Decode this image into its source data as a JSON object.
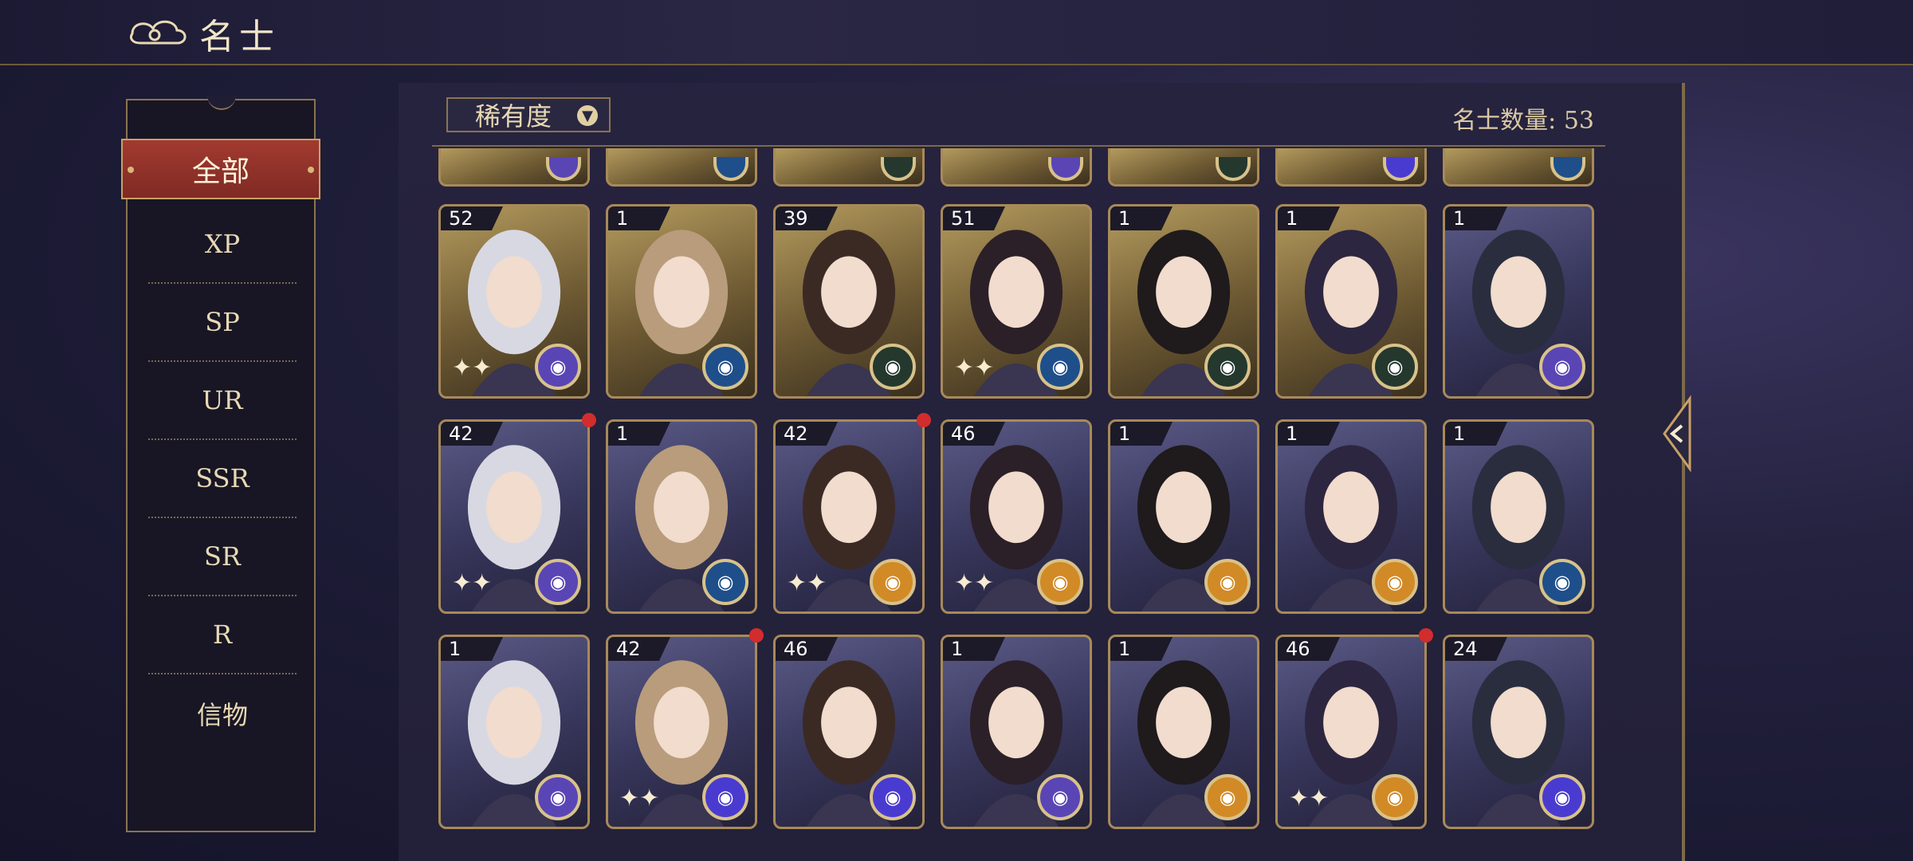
{
  "header": {
    "title": "名士"
  },
  "filters": {
    "items": [
      "全部",
      "XP",
      "SP",
      "UR",
      "SSR",
      "SR",
      "R",
      "信物"
    ],
    "active": "全部"
  },
  "toolbar": {
    "sort_label": "稀有度"
  },
  "count": {
    "text": "名士数量: 53"
  },
  "partial_row": [
    {
      "badge": "purple"
    },
    {
      "badge": "blue"
    },
    {
      "badge": "dark"
    },
    {
      "badge": "purple"
    },
    {
      "badge": "dark"
    },
    {
      "badge": "violet"
    },
    {
      "badge": "blue"
    }
  ],
  "rows": [
    [
      {
        "level": "52",
        "tint": "gold",
        "badge": "purple",
        "sparkle": true,
        "alert": false
      },
      {
        "level": "1",
        "tint": "gold",
        "badge": "blue",
        "sparkle": false,
        "alert": false
      },
      {
        "level": "39",
        "tint": "gold",
        "badge": "dark",
        "sparkle": false,
        "alert": false
      },
      {
        "level": "51",
        "tint": "gold",
        "badge": "blue",
        "sparkle": true,
        "alert": false
      },
      {
        "level": "1",
        "tint": "gold",
        "badge": "dark",
        "sparkle": false,
        "alert": false
      },
      {
        "level": "1",
        "tint": "gold",
        "badge": "dark",
        "sparkle": false,
        "alert": false
      },
      {
        "level": "1",
        "tint": "violet",
        "badge": "purple",
        "sparkle": false,
        "alert": false
      }
    ],
    [
      {
        "level": "42",
        "tint": "violet",
        "badge": "purple",
        "sparkle": true,
        "alert": true
      },
      {
        "level": "1",
        "tint": "violet",
        "badge": "blue",
        "sparkle": false,
        "alert": false
      },
      {
        "level": "42",
        "tint": "violet",
        "badge": "orange",
        "sparkle": true,
        "alert": true
      },
      {
        "level": "46",
        "tint": "violet",
        "badge": "orange",
        "sparkle": true,
        "alert": false
      },
      {
        "level": "1",
        "tint": "violet",
        "badge": "orange",
        "sparkle": false,
        "alert": false
      },
      {
        "level": "1",
        "tint": "violet",
        "badge": "orange",
        "sparkle": false,
        "alert": false
      },
      {
        "level": "1",
        "tint": "violet",
        "badge": "blue",
        "sparkle": false,
        "alert": false
      }
    ],
    [
      {
        "level": "1",
        "tint": "violet",
        "badge": "purple",
        "sparkle": false,
        "alert": false
      },
      {
        "level": "42",
        "tint": "violet",
        "badge": "violet",
        "sparkle": true,
        "alert": true
      },
      {
        "level": "46",
        "tint": "violet",
        "badge": "violet",
        "sparkle": false,
        "alert": false
      },
      {
        "level": "1",
        "tint": "violet",
        "badge": "purple",
        "sparkle": false,
        "alert": false
      },
      {
        "level": "1",
        "tint": "violet",
        "badge": "orange",
        "sparkle": false,
        "alert": false
      },
      {
        "level": "46",
        "tint": "violet",
        "badge": "orange",
        "sparkle": true,
        "alert": true
      },
      {
        "level": "24",
        "tint": "violet",
        "badge": "violet",
        "sparkle": false,
        "alert": false
      }
    ]
  ]
}
